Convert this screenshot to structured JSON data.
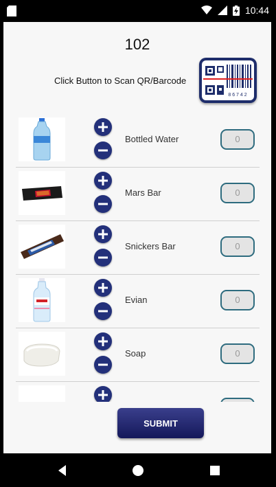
{
  "status_bar": {
    "time": "10:44"
  },
  "header": {
    "counter": "102",
    "scan_label": "Click Button to Scan QR/Barcode",
    "qr_digits": "8 6 7 4 2"
  },
  "items": [
    {
      "name": "Bottled Water",
      "quantity": "0",
      "image": "water-bottle"
    },
    {
      "name": "Mars Bar",
      "quantity": "0",
      "image": "mars-bar"
    },
    {
      "name": "Snickers Bar",
      "quantity": "0",
      "image": "snickers-bar"
    },
    {
      "name": "Evian",
      "quantity": "0",
      "image": "evian-bottle"
    },
    {
      "name": "Soap",
      "quantity": "0",
      "image": "soap-bar"
    },
    {
      "name": "",
      "quantity": "",
      "image": "partial-item"
    }
  ],
  "buttons": {
    "submit": "SUBMIT"
  },
  "colors": {
    "accent": "#23307a",
    "qty_border": "#2d6b7e"
  }
}
